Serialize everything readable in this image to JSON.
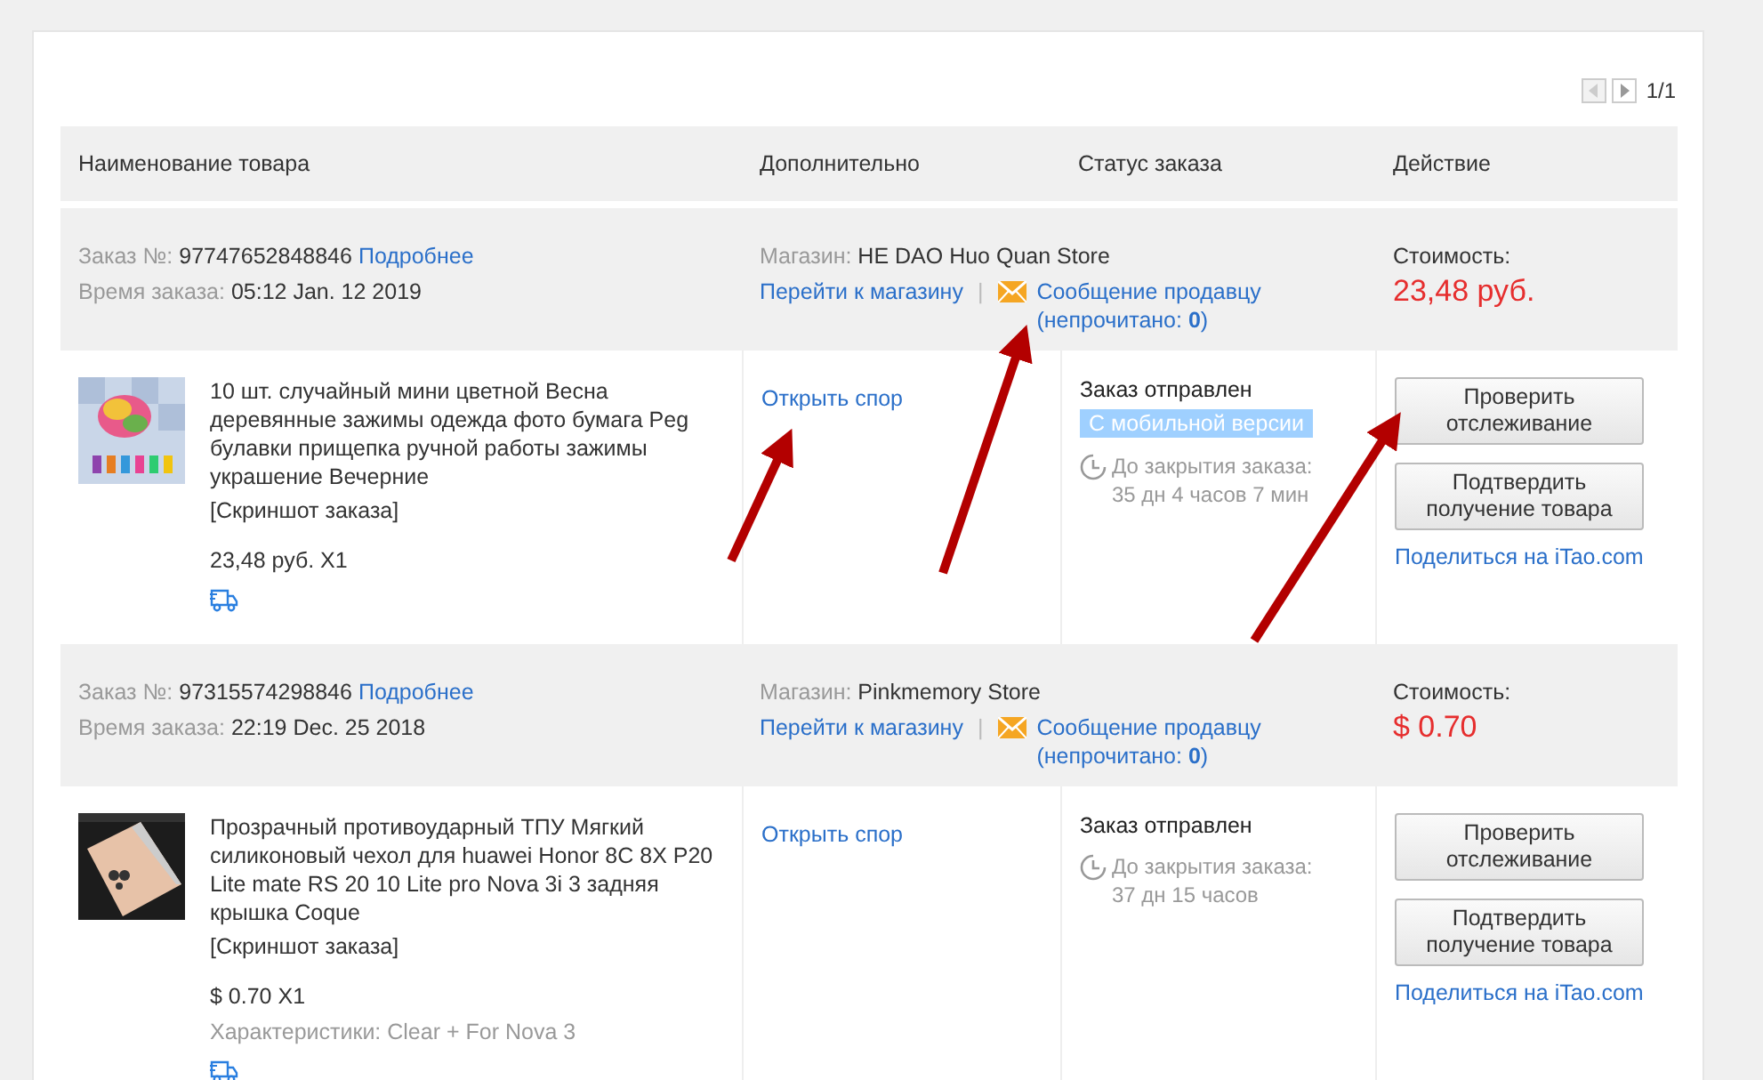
{
  "pager": {
    "prev_disabled": true,
    "next_disabled": false,
    "text": "1/1"
  },
  "columns": [
    "Наименование товара",
    "Дополнительно",
    "Статус заказа",
    "Действие"
  ],
  "orders": [
    {
      "order_label": "Заказ №:",
      "order_no": "97747652848846",
      "details_link": "Подробнее",
      "time_label": "Время заказа:",
      "time": "05:12 Jan. 12 2019",
      "store_label": "Магазин:",
      "store": "HE DAO Huo Quan Store",
      "store_link": "Перейти к магазину",
      "separator": "|",
      "message_link": "Сообщение продавцу",
      "unread": "(непрочитано: **0**)",
      "cost_label": "Стоимость:",
      "cost": "23,48 руб.",
      "product": {
        "kind": "picture",
        "title": "10 шт. случайный мини цветной Весна деревянные зажимы одежда фото бумага Peg булавки прищепка ручной работы зажимы украшение Вечерние",
        "snapshot": "[Скриншот заказа]",
        "price": "23,48 руб. X1"
      },
      "dispute_link": "Открыть спор",
      "status": "Заказ отправлен",
      "tag": "С мобильной версии",
      "countdown": "До закрытия заказа: 35 дн 4 часов 7 мин",
      "buttons": [
        "Проверить отслеживание",
        "Подтвердить получение товара"
      ],
      "share_link": "Поделиться на iTao.com"
    },
    {
      "order_label": "Заказ №:",
      "order_no": "97315574298846",
      "details_link": "Подробнее",
      "time_label": "Время заказа:",
      "time": "22:19 Dec. 25 2018",
      "store_label": "Магазин:",
      "store": "Pinkmemory Store",
      "store_link": "Перейти к магазину",
      "separator": "|",
      "message_link": "Сообщение продавцу",
      "unread": "(непрочитано: **0**)",
      "cost_label": "Стоимость:",
      "cost": "$ 0.70",
      "product": {
        "kind": "picture",
        "title": "Прозрачный противоударный ТПУ Мягкий силиконовый чехол для huawei Honor 8C 8X P20 Lite mate RS 20 10 Lite pro Nova 3i 3 задняя крышка Coque",
        "snapshot": "[Скриншот заказа]",
        "price": "$ 0.70 X1",
        "specs": "Характеристики: Clear + For Nova 3"
      },
      "dispute_link": "Открыть спор",
      "status": "Заказ отправлен",
      "countdown": "До закрытия заказа: 37 дн 15 часов",
      "buttons": [
        "Проверить отслеживание",
        "Подтвердить получение товара"
      ],
      "share_link": "Поделиться на iTao.com"
    }
  ]
}
